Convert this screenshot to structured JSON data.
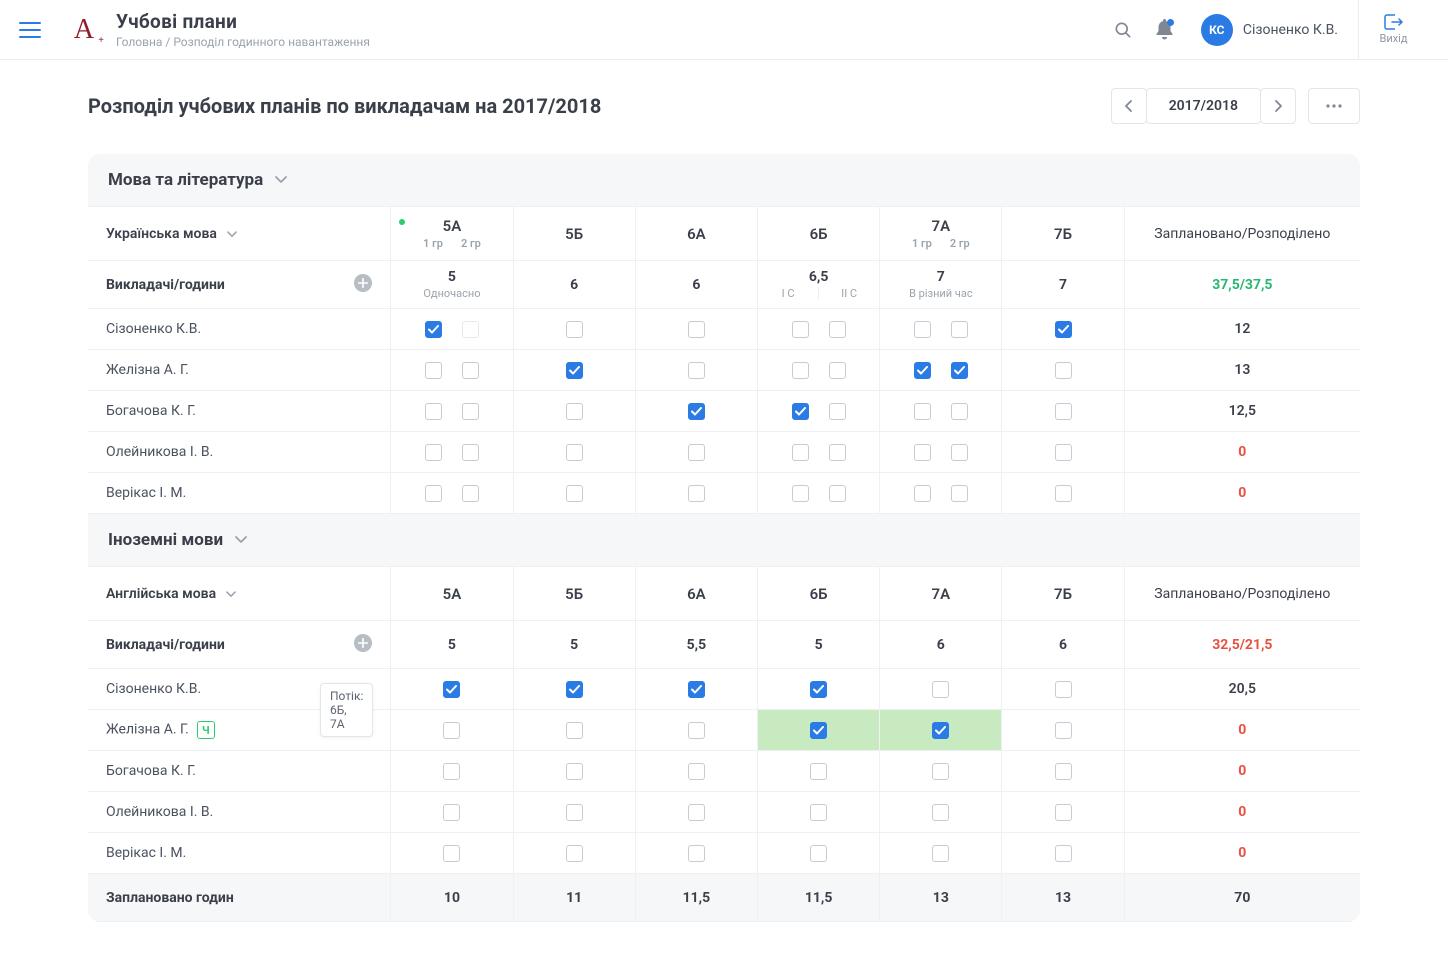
{
  "header": {
    "title": "Учбові плани",
    "breadcrumb": "Головна / Розподіл годинного навантаження",
    "avatar": "КС",
    "username": "Сізоненко К.В.",
    "exit": "Вихід"
  },
  "page": {
    "heading": "Розподіл учбових планів по викладачам на 2017/2018",
    "year": "2017/2018"
  },
  "sec1": {
    "title": "Мова та література",
    "subject": "Українська мова",
    "classes": {
      "c5a": {
        "name": "5А",
        "g1": "1 гр",
        "g2": "2 гр"
      },
      "c5b": {
        "name": "5Б"
      },
      "c6a": {
        "name": "6А"
      },
      "c6b": {
        "name": "6Б"
      },
      "c7a": {
        "name": "7А",
        "g1": "1 гр",
        "g2": "2 гр"
      },
      "c7b": {
        "name": "7Б"
      }
    },
    "sum_head": "Заплановано/Розподілено",
    "teachers_label": "Викладачі/години",
    "hours": {
      "c5a": "5",
      "c5a_sub": "Одночасно",
      "c5b": "6",
      "c6a": "6",
      "c6b": "6,5",
      "c6b_l": "І С",
      "c6b_r": "ІІ С",
      "c7a": "7",
      "c7a_sub": "В різний час",
      "c7b": "7",
      "sum": "37,5/37,5"
    },
    "rows": [
      {
        "name": "Сізоненко К.В.",
        "c5a": [
          true,
          false
        ],
        "c5b": [
          false
        ],
        "c6a": [
          false
        ],
        "c6b": [
          false,
          false
        ],
        "c7a": [
          false,
          false
        ],
        "c7b": [
          true
        ],
        "sum": "12"
      },
      {
        "name": "Желізна А. Г.",
        "c5a": [
          false,
          false
        ],
        "c5b": [
          true
        ],
        "c6a": [
          false
        ],
        "c6b": [
          false,
          false
        ],
        "c7a": [
          true,
          true
        ],
        "c7b": [
          false
        ],
        "sum": "13"
      },
      {
        "name": "Богачова К. Г.",
        "c5a": [
          false,
          false
        ],
        "c5b": [
          false
        ],
        "c6a": [
          true
        ],
        "c6b": [
          true,
          false
        ],
        "c7a": [
          false,
          false
        ],
        "c7b": [
          false
        ],
        "sum": "12,5"
      },
      {
        "name": "Олейникова І. В.",
        "c5a": [
          false,
          false
        ],
        "c5b": [
          false
        ],
        "c6a": [
          false
        ],
        "c6b": [
          false,
          false
        ],
        "c7a": [
          false,
          false
        ],
        "c7b": [
          false
        ],
        "sum": "0",
        "red": true
      },
      {
        "name": "Верікас І. М.",
        "c5a": [
          false,
          false
        ],
        "c5b": [
          false
        ],
        "c6a": [
          false
        ],
        "c6b": [
          false,
          false
        ],
        "c7a": [
          false,
          false
        ],
        "c7b": [
          false
        ],
        "sum": "0",
        "red": true
      }
    ]
  },
  "sec2": {
    "title": "Іноземні мови",
    "subject": "Англійська мова",
    "classes": {
      "c5a": "5А",
      "c5b": "5Б",
      "c6a": "6А",
      "c6b": "6Б",
      "c7a": "7А",
      "c7b": "7Б"
    },
    "sum_head": "Заплановано/Розподілено",
    "teachers_label": "Викладачі/години",
    "hours": {
      "c5a": "5",
      "c5b": "5",
      "c6a": "5,5",
      "c6b": "5",
      "c7a": "6",
      "c7b": "6",
      "sum": "32,5/21,5"
    },
    "tooltip": "Потік: 6Б, 7А",
    "badge": "Ч",
    "rows": [
      {
        "name": "Сізоненко К.В.",
        "cells": [
          true,
          true,
          true,
          true,
          false,
          false
        ],
        "sum": "20,5"
      },
      {
        "name": "Желізна А. Г.",
        "cells": [
          false,
          false,
          false,
          true,
          true,
          false
        ],
        "sum": "0",
        "red": true,
        "badge": true,
        "hi": [
          3,
          4
        ]
      },
      {
        "name": "Богачова К. Г.",
        "cells": [
          false,
          false,
          false,
          false,
          false,
          false
        ],
        "sum": "0",
        "red": true
      },
      {
        "name": "Олейникова І. В.",
        "cells": [
          false,
          false,
          false,
          false,
          false,
          false
        ],
        "sum": "0",
        "red": true
      },
      {
        "name": "Верікас І. М.",
        "cells": [
          false,
          false,
          false,
          false,
          false,
          false
        ],
        "sum": "0",
        "red": true
      }
    ],
    "footer": {
      "label": "Заплановано годин",
      "vals": [
        "10",
        "11",
        "11,5",
        "11,5",
        "13",
        "13"
      ],
      "sum": "70"
    }
  }
}
